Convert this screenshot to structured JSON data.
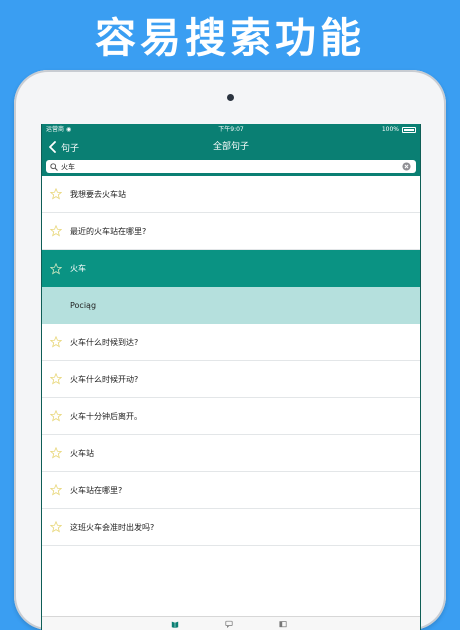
{
  "headline": "容易搜索功能",
  "colors": {
    "background": "#3a9ef2",
    "accent": "#0a7f73",
    "selected_row": "#0a9383",
    "translation_row": "#b5e0dd",
    "star_outline": "#e8d77a"
  },
  "status_bar": {
    "carrier": "运营商",
    "time": "下午9:07",
    "battery": "100%"
  },
  "nav": {
    "back_label": "句子",
    "title": "全部句子"
  },
  "search": {
    "value": "火车"
  },
  "rows": [
    {
      "text": "我想要去火车站"
    },
    {
      "text": "最近的火车站在哪里?"
    },
    {
      "text": "火车",
      "selected": true
    },
    {
      "text": "Pociąg",
      "translation": true
    },
    {
      "text": "火车什么时候到达?"
    },
    {
      "text": "火车什么时候开动?"
    },
    {
      "text": "火车十分钟后离开。"
    },
    {
      "text": "火车站"
    },
    {
      "text": "火车站在哪里?"
    },
    {
      "text": "这班火车会准时出发吗?"
    }
  ],
  "tabs": [
    {
      "icon": "book-icon",
      "active": true
    },
    {
      "icon": "chat-icon"
    },
    {
      "icon": "cards-icon"
    }
  ]
}
